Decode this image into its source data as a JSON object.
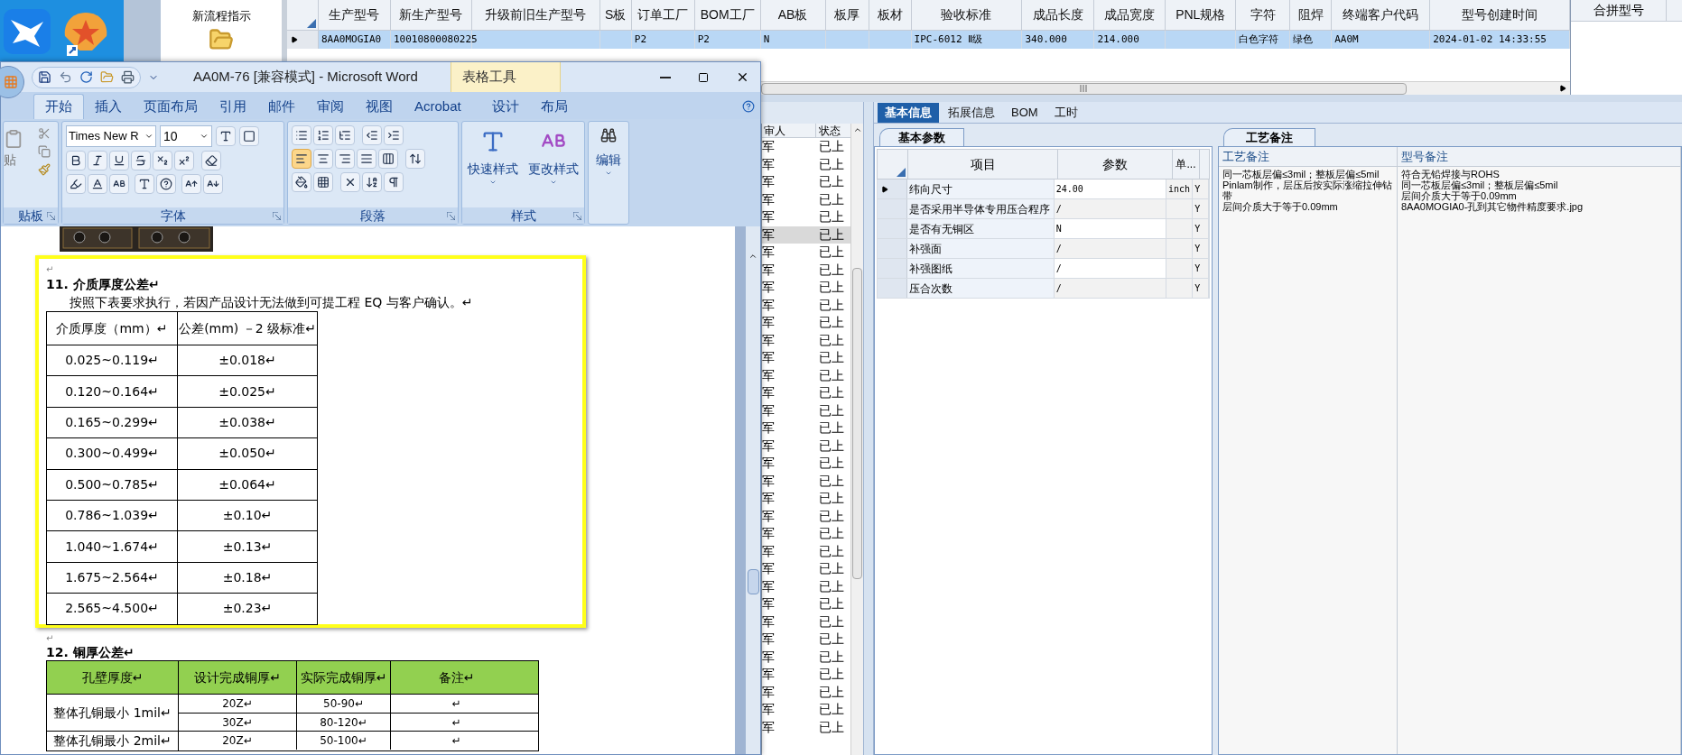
{
  "launcher": {
    "label": "新流程指示"
  },
  "top_grid": {
    "columns": [
      "生产型号",
      "新生产型号",
      "升级前旧生产型号",
      "S板",
      "订单工厂",
      "BOM工厂",
      "AB板",
      "板厚",
      "板材",
      "验收标准",
      "成品长度",
      "成品宽度",
      "PNL规格",
      "字符",
      "阻焊",
      "终端客户代码",
      "型号创建时间"
    ],
    "rows": [
      {
        "selected": true,
        "cells": [
          "8AA0MOGIA0",
          "10010800080225",
          null,
          null,
          "P2",
          "P2",
          "N",
          null,
          null,
          "IPC-6012 Ⅱ级",
          "340.000",
          "214.000",
          null,
          "白色字符",
          "绿色",
          "AA0M",
          "2024-01-02 14:33:55"
        ]
      }
    ]
  },
  "merge_panel": {
    "columns": [
      "合拼型号"
    ]
  },
  "list": {
    "columns": [
      "审人",
      "状态"
    ],
    "rows": [
      {
        "reviewer": "军",
        "status": "已上",
        "selected": false
      },
      {
        "reviewer": "军",
        "status": "已上",
        "selected": false
      },
      {
        "reviewer": "军",
        "status": "已上",
        "selected": false
      },
      {
        "reviewer": "军",
        "status": "已上",
        "selected": false
      },
      {
        "reviewer": "军",
        "status": "已上",
        "selected": false
      },
      {
        "reviewer": "军",
        "status": "已上",
        "selected": true
      },
      {
        "reviewer": "军",
        "status": "已上",
        "selected": false
      },
      {
        "reviewer": "军",
        "status": "已上",
        "selected": false
      },
      {
        "reviewer": "军",
        "status": "已上",
        "selected": false
      },
      {
        "reviewer": "军",
        "status": "已上",
        "selected": false
      },
      {
        "reviewer": "军",
        "status": "已上",
        "selected": false
      },
      {
        "reviewer": "军",
        "status": "已上",
        "selected": false
      },
      {
        "reviewer": "军",
        "status": "已上",
        "selected": false
      },
      {
        "reviewer": "军",
        "status": "已上",
        "selected": false
      },
      {
        "reviewer": "军",
        "status": "已上",
        "selected": false
      },
      {
        "reviewer": "军",
        "status": "已上",
        "selected": false
      },
      {
        "reviewer": "军",
        "status": "已上",
        "selected": false
      },
      {
        "reviewer": "军",
        "status": "已上",
        "selected": false
      },
      {
        "reviewer": "军",
        "status": "已上",
        "selected": false
      },
      {
        "reviewer": "军",
        "status": "已上",
        "selected": false
      },
      {
        "reviewer": "军",
        "status": "已上",
        "selected": false
      },
      {
        "reviewer": "军",
        "status": "已上",
        "selected": false
      },
      {
        "reviewer": "军",
        "status": "已上",
        "selected": false
      },
      {
        "reviewer": "军",
        "status": "已上",
        "selected": false
      },
      {
        "reviewer": "军",
        "status": "已上",
        "selected": false
      },
      {
        "reviewer": "军",
        "status": "已上",
        "selected": false
      },
      {
        "reviewer": "军",
        "status": "已上",
        "selected": false
      },
      {
        "reviewer": "军",
        "status": "已上",
        "selected": false
      },
      {
        "reviewer": "军",
        "status": "已上",
        "selected": false
      },
      {
        "reviewer": "军",
        "status": "已上",
        "selected": false
      },
      {
        "reviewer": "军",
        "status": "已上",
        "selected": false
      },
      {
        "reviewer": "军",
        "status": "已上",
        "selected": false
      },
      {
        "reviewer": "军",
        "status": "已上",
        "selected": false
      },
      {
        "reviewer": "军",
        "status": "已上",
        "selected": false
      }
    ]
  },
  "detail": {
    "tabs": [
      {
        "label": "基本信息",
        "selected": true
      },
      {
        "label": "拓展信息",
        "selected": false
      },
      {
        "label": "BOM",
        "selected": false
      },
      {
        "label": "工时",
        "selected": false
      }
    ],
    "params": {
      "tab": "基本参数",
      "columns": [
        "项目",
        "参数",
        "单..."
      ],
      "rows": [
        {
          "current": true,
          "cells": [
            "纬向尺寸",
            "24.00",
            "inch",
            "Y"
          ]
        },
        {
          "current": false,
          "cells": [
            "是否采用半导体专用压合程序",
            "/",
            null,
            "Y"
          ]
        },
        {
          "current": false,
          "cells": [
            "是否有无铜区",
            "N",
            null,
            "Y"
          ]
        },
        {
          "current": false,
          "cells": [
            "补强面",
            "/",
            null,
            "Y"
          ]
        },
        {
          "current": false,
          "cells": [
            "补强图纸",
            "/",
            null,
            "Y"
          ]
        },
        {
          "current": false,
          "cells": [
            "压合次数",
            "/",
            null,
            "Y"
          ]
        }
      ]
    },
    "notes": {
      "tab": "工艺备注",
      "columns": [
        {
          "title": "工艺备注",
          "lines": [
            "同一芯板层偏≤3mil；整板层偏≤5mil",
            "Pinlam制作，层压后按实际涨缩拉伸钻带",
            "层间介质大于等于0.09mm"
          ]
        },
        {
          "title": "型号备注",
          "lines": [
            "符合无铅焊接与ROHS",
            "同一芯板层偏≤3mil；整板层偏≤5mil",
            "层间介质大于等于0.09mm",
            "8AA0MOGIA0-孔到其它物件精度要求.jpg"
          ]
        }
      ]
    }
  },
  "word": {
    "title": "AA0M-76 [兼容模式] - Microsoft Word",
    "context_group": "表格工具",
    "tabs": [
      {
        "label": "开始",
        "selected": true
      },
      {
        "label": "插入",
        "selected": false
      },
      {
        "label": "页面布局",
        "selected": false
      },
      {
        "label": "引用",
        "selected": false
      },
      {
        "label": "邮件",
        "selected": false
      },
      {
        "label": "审阅",
        "selected": false
      },
      {
        "label": "视图",
        "selected": false
      },
      {
        "label": "Acrobat",
        "selected": false
      },
      {
        "label": "设计",
        "selected": false
      },
      {
        "label": "布局",
        "selected": false
      }
    ],
    "paste_label": "贴",
    "font_name": "Times New R",
    "font_size": "10",
    "groups": [
      "贴板",
      "字体",
      "段落",
      "样式"
    ],
    "style_buttons": [
      "快速样式",
      "更改样式"
    ],
    "edit_button": "编辑"
  },
  "document": {
    "section11": {
      "mark": "↵",
      "heading": "11. 介质厚度公差↵",
      "paragraph": "按照下表要求执行，若因产品设计无法做到可提工程 EQ 与客户确认。↵",
      "columns": [
        "介质厚度（mm）↵",
        "公差(mm) －2 级标准↵"
      ],
      "rows": [
        [
          "0.025~0.119↵",
          "±0.018↵"
        ],
        [
          "0.120~0.164↵",
          "±0.025↵"
        ],
        [
          "0.165~0.299↵",
          "±0.038↵"
        ],
        [
          "0.300~0.499↵",
          "±0.050↵"
        ],
        [
          "0.500~0.785↵",
          "±0.064↵"
        ],
        [
          "0.786~1.039↵",
          "±0.10↵"
        ],
        [
          "1.040~1.674↵",
          "±0.13↵"
        ],
        [
          "1.675~2.564↵",
          "±0.18↵"
        ],
        [
          "2.565~4.500↵",
          "±0.23↵"
        ]
      ]
    },
    "section12": {
      "mark": "↵",
      "heading": "12. 铜厚公差↵",
      "columns": [
        "孔壁厚度↵",
        "设计完成铜厚↵",
        "实际完成铜厚↵",
        "备注↵"
      ],
      "groups": [
        {
          "label": "整体孔铜最小 1mil↵",
          "rows": [
            [
              "20Z↵",
              "50-90↵",
              "↵"
            ],
            [
              "30Z↵",
              "80-120↵",
              "↵"
            ]
          ]
        },
        {
          "label": "整体孔铜最小 2mil↵",
          "rows": [
            [
              "20Z↵",
              "50-100↵",
              "↵"
            ]
          ]
        }
      ]
    }
  }
}
